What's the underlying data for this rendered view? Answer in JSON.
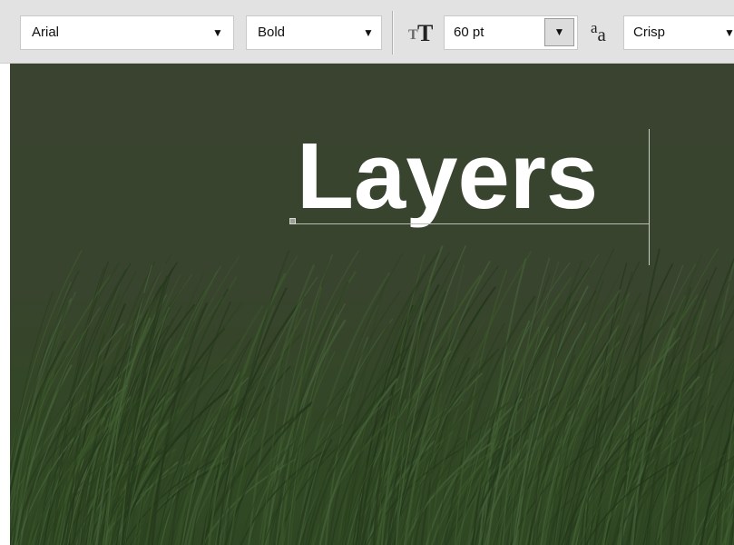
{
  "options_bar": {
    "font_family": "Arial",
    "font_style": "Bold",
    "font_size": "60 pt",
    "antialias": "Crisp",
    "icons": {
      "font_size": "font-size-icon",
      "antialias": "anti-alias-icon",
      "dropdown": "chevron-down-icon"
    },
    "size_icon_glyphs": {
      "small": "T",
      "large": "T"
    },
    "antialias_icon_glyphs": {
      "first": "a",
      "second": "a"
    },
    "arrow_glyph": "▼"
  },
  "canvas": {
    "text": "Layers",
    "background_colors": {
      "top": "#39432f",
      "bottom": "#2f4823"
    },
    "text_color": "#ffffff"
  }
}
